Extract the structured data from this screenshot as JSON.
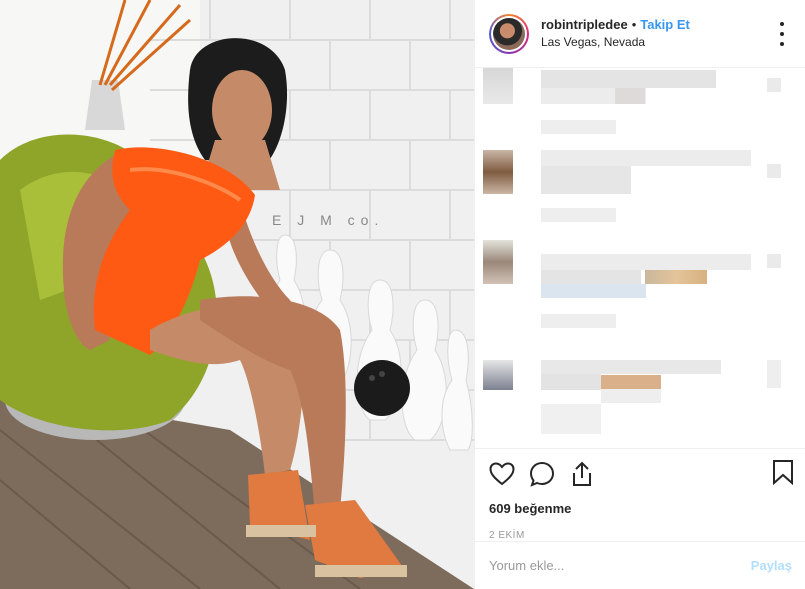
{
  "post": {
    "username": "robintripledee",
    "separator": "•",
    "follow_label": "Takip Et",
    "location": "Las Vegas, Nevada",
    "likes": "609 beğenme",
    "date": "2 EKİM"
  },
  "photo": {
    "watermark": "E J M co."
  },
  "comment_box": {
    "placeholder": "Yorum ekle...",
    "post_label": "Paylaş"
  },
  "icons": {
    "more": "more-options-icon",
    "like": "heart-icon",
    "comment": "comment-bubble-icon",
    "share": "share-upload-icon",
    "save": "bookmark-icon"
  },
  "colors": {
    "link": "#3897f0",
    "post_disabled": "#b2dffc",
    "dress": "#ff5a14",
    "chair": "#8fa52a",
    "wall": "#f1f1f1"
  }
}
